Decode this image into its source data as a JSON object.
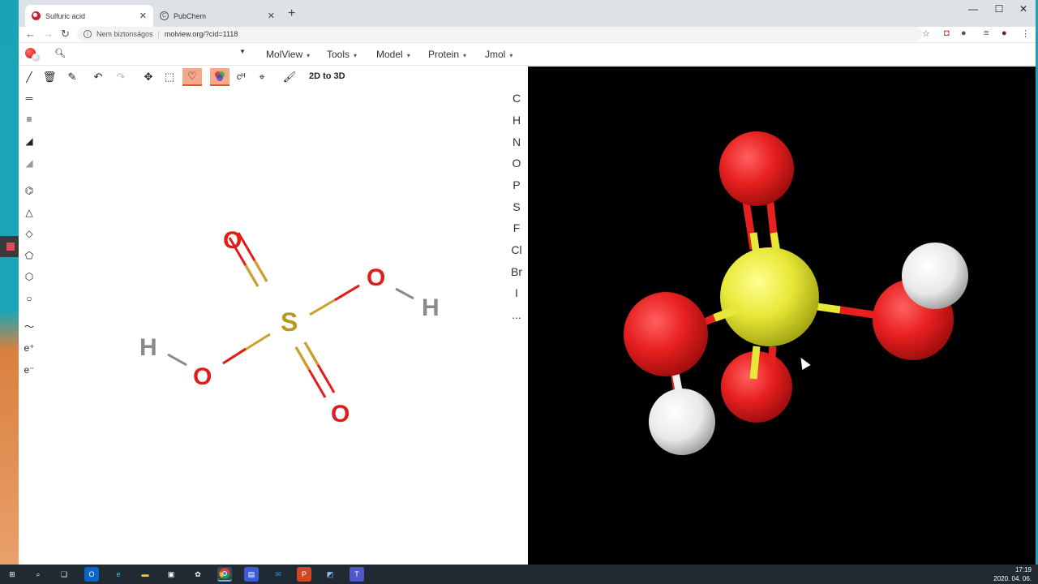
{
  "browser": {
    "tabs": [
      {
        "title": "Sulfuric acid",
        "active": true
      },
      {
        "title": "PubChem",
        "active": false
      }
    ],
    "security_label": "Nem biztonságos",
    "url": "molview.org/?cid=1118"
  },
  "menubar": {
    "search_placeholder": "",
    "items": [
      "MolView",
      "Tools",
      "Model",
      "Protein",
      "Jmol"
    ]
  },
  "sketcher": {
    "convert_label": "2D to 3D",
    "elements": [
      "C",
      "H",
      "N",
      "O",
      "P",
      "S",
      "F",
      "Cl",
      "Br",
      "I",
      "..."
    ],
    "charge_plus": "e⁺",
    "charge_minus": "e⁻",
    "atoms": {
      "o_top": "O",
      "o_right": "O",
      "h_right": "H",
      "s_center": "S",
      "h_left": "H",
      "o_left": "O",
      "o_bottom": "O"
    }
  },
  "colors": {
    "oxygen": "#e21b1b",
    "sulfur": "#b8991e",
    "hydrogen": "#8a8a8a",
    "active_tool": "#f6a98a"
  },
  "taskbar": {
    "time": "17:19",
    "date": "2020. 04. 06."
  }
}
